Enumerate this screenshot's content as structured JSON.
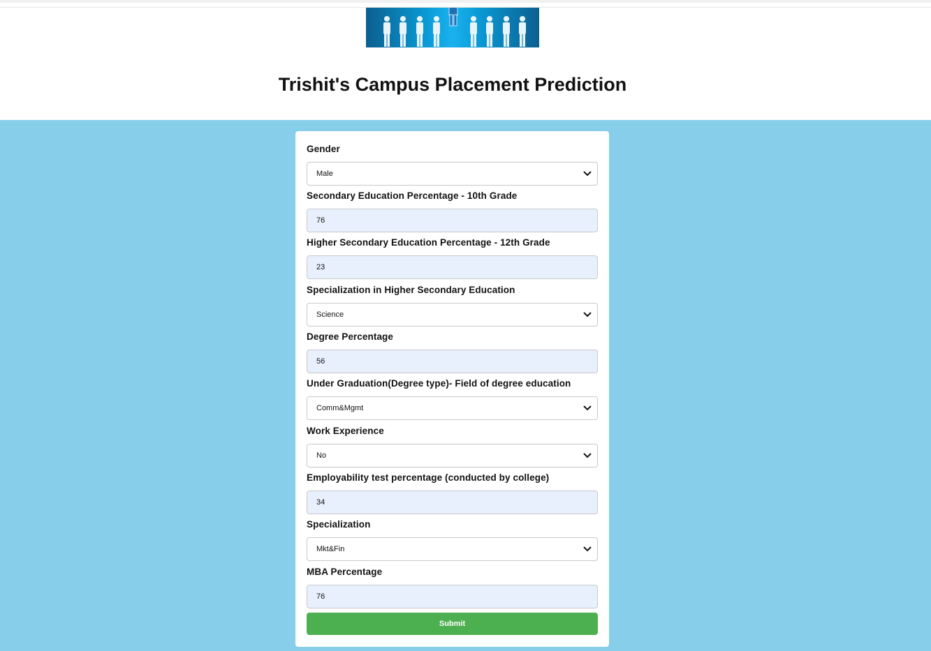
{
  "header": {
    "title": "Trishit's Campus Placement Prediction",
    "banner_icon": "people-group-banner"
  },
  "colors": {
    "page_background": "#87ceeb",
    "input_fill": "#e8f0fe",
    "submit_button": "#4caf50"
  },
  "form": {
    "fields": [
      {
        "label": "Gender",
        "type": "select",
        "value": "Male"
      },
      {
        "label": "Secondary Education Percentage - 10th Grade",
        "type": "input",
        "value": "76"
      },
      {
        "label": "Higher Secondary Education Percentage - 12th Grade",
        "type": "input",
        "value": "23"
      },
      {
        "label": "Specialization in Higher Secondary Education",
        "type": "select",
        "value": "Science"
      },
      {
        "label": "Degree Percentage",
        "type": "input",
        "value": "56"
      },
      {
        "label": "Under Graduation(Degree type)- Field of degree education",
        "type": "select",
        "value": "Comm&Mgmt"
      },
      {
        "label": "Work Experience",
        "type": "select",
        "value": "No"
      },
      {
        "label": "Employability test percentage (conducted by college)",
        "type": "input",
        "value": "34"
      },
      {
        "label": "Specialization",
        "type": "select",
        "value": "Mkt&Fin"
      },
      {
        "label": "MBA Percentage",
        "type": "input",
        "value": "76"
      }
    ],
    "submit_label": "Submit"
  }
}
